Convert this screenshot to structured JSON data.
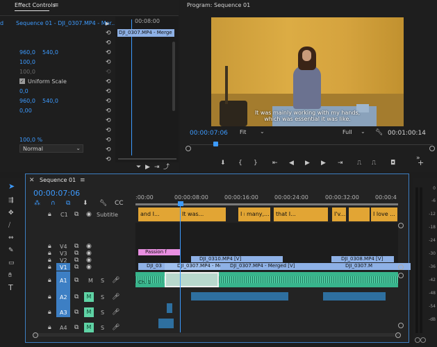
{
  "effect_controls": {
    "tab_title": "Effect Controls",
    "sequence_label": "d",
    "clip_path": "Sequence 01 - DJI_0307.MP4 - Mer...",
    "timeline_time": "00:08:00",
    "timeline_clip": "DJI_0307.MP4 - Merge",
    "props": {
      "position_x": "960,0",
      "position_y": "540,0",
      "scale": "100,0",
      "scale_width": "100,0",
      "uniform_scale": "Uniform Scale",
      "rotation": "0,0",
      "anchor_x": "960,0",
      "anchor_y": "540,0",
      "anti_flicker": "0,00",
      "opacity": "100,0 %",
      "blend_mode": "Normal"
    }
  },
  "program": {
    "title": "Program: Sequence 01",
    "subtitle_line1": "It was mainly working with my hands,",
    "subtitle_line2": "which was essential it was like.",
    "timecode": "00:00:07:06",
    "fit": "Fit",
    "quality": "Full",
    "duration": "00:01:00:14"
  },
  "sequence": {
    "tab": "Sequence 01",
    "timecode": "00:00:07:06",
    "ruler": [
      ":00:00",
      "00:00:08:00",
      "00:00:16:00",
      "00:00:24:00",
      "00:00:32:00",
      "00:00:4"
    ],
    "subtitle_track": "Subtitle",
    "c1": "C1",
    "subtitles": [
      "and I...",
      "It was...",
      "I r...",
      "many,...",
      "that I...",
      "I'v...",
      "I love ..."
    ],
    "tracks_v": [
      "V4",
      "V3",
      "V2",
      "V1"
    ],
    "tracks_a": [
      "A1",
      "A2",
      "A3",
      "A4"
    ],
    "m": "M",
    "s": "S",
    "clips": {
      "passion": "Passion f",
      "dji0310": "DJI_0310.MP4 [V]",
      "dji0308": "DJI_0308.MP4 [V]",
      "v1_a": "DJI_03",
      "v1_b": "DJI_0307.MP4 - Mer",
      "v1_c": "DJI_0307.MP4 - Merged [V]",
      "v1_d": "DJI_0307.M",
      "ch1": "Ch. 1"
    }
  },
  "meter": {
    "labels": [
      "0",
      "-6",
      "-12",
      "-18",
      "-24",
      "-30",
      "-36",
      "-42",
      "-48",
      "-54",
      "-dB"
    ]
  },
  "colors": {
    "accent": "#3d9bff",
    "subtitle": "#e2a534",
    "audio": "#38b48c",
    "video_clip": "#8eb1e6",
    "pink_clip": "#e98fe1"
  }
}
